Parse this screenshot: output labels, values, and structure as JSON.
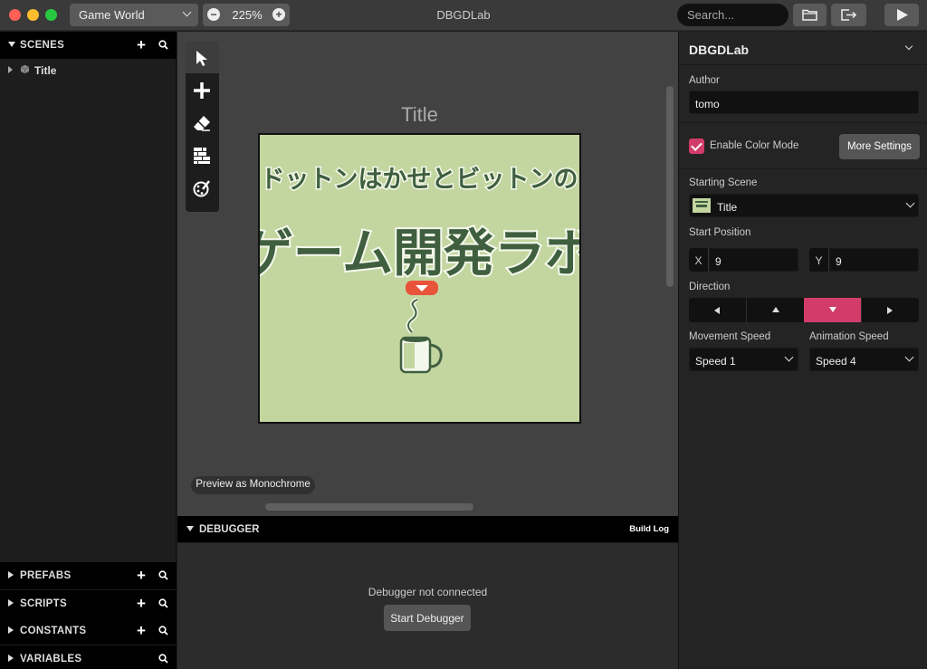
{
  "titlebar": {
    "world": "Game World",
    "zoom": "225%",
    "app_title": "DBGDLab",
    "search_placeholder": "Search..."
  },
  "sidebar": {
    "scenes_label": "SCENES",
    "scene_items": [
      {
        "label": "Title"
      }
    ],
    "prefabs_label": "PREFABS",
    "scripts_label": "SCRIPTS",
    "constants_label": "CONSTANTS",
    "variables_label": "VARIABLES"
  },
  "canvas": {
    "scene_title": "Title",
    "scene_image_lines": [
      "ドットンはかせとビットンの",
      "ゲーム開発ラボ"
    ],
    "preview_label": "Preview as Monochrome",
    "tools": [
      "select-icon",
      "add-icon",
      "eraser-icon",
      "collisions-icon",
      "paint-icon"
    ]
  },
  "debugger": {
    "label": "DEBUGGER",
    "build_log": "Build Log",
    "status": "Debugger not connected",
    "start_label": "Start Debugger"
  },
  "properties": {
    "project_name": "DBGDLab",
    "author_label": "Author",
    "author_value": "tomo",
    "color_mode_label": "Enable Color Mode",
    "color_mode_checked": true,
    "more_settings": "More Settings",
    "starting_scene_label": "Starting Scene",
    "starting_scene_value": "Title",
    "start_position_label": "Start Position",
    "x_label": "X",
    "x_value": "9",
    "y_label": "Y",
    "y_value": "9",
    "direction_label": "Direction",
    "direction_selected": "down",
    "movement_speed_label": "Movement Speed",
    "movement_speed_value": "Speed 1",
    "animation_speed_label": "Animation Speed",
    "animation_speed_value": "Speed 4"
  },
  "colors": {
    "accent": "#d23c6a",
    "scene_bg": "#c3d6a0",
    "scene_ink": "#3f5f3f",
    "marker": "#e8533a"
  }
}
